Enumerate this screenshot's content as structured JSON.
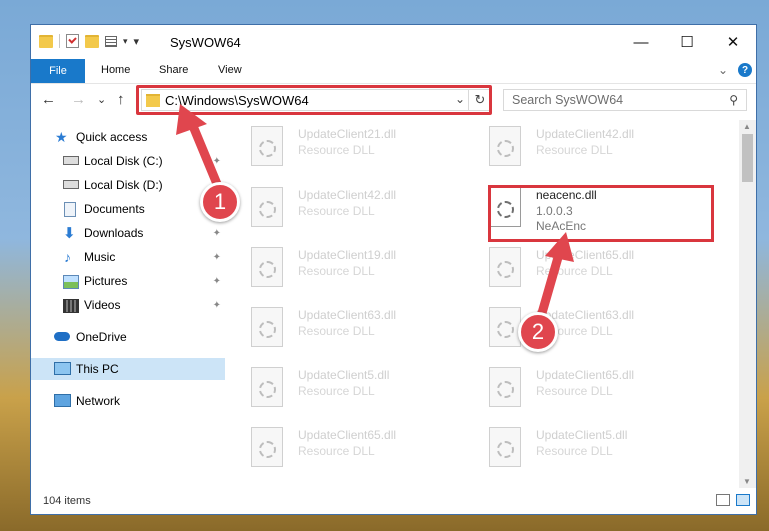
{
  "window": {
    "title": "SysWOW64",
    "close_glyph": "✕",
    "max_glyph": "☐",
    "min_glyph": "—"
  },
  "ribbon": {
    "file": "File",
    "tabs": [
      "Home",
      "Share",
      "View"
    ],
    "expand": "⌄",
    "help": "?"
  },
  "nav": {
    "back": "←",
    "forward": "→",
    "recent": "⌄",
    "up": "↑"
  },
  "address": {
    "path": "C:\\Windows\\SysWOW64",
    "dropdown": "⌄",
    "refresh": "↻"
  },
  "search": {
    "placeholder": "Search SysWOW64",
    "icon": "⚲"
  },
  "sidebar": {
    "items": [
      {
        "label": "Quick access",
        "icon": "star-icon",
        "color": "#2b7cd3"
      },
      {
        "label": "Local Disk (C:)",
        "icon": "drive-icon",
        "pinned": true
      },
      {
        "label": "Local Disk (D:)",
        "icon": "drive-icon"
      },
      {
        "label": "Documents",
        "icon": "documents-icon"
      },
      {
        "label": "Downloads",
        "icon": "download-icon",
        "pinned": true
      },
      {
        "label": "Music",
        "icon": "music-icon",
        "pinned": true
      },
      {
        "label": "Pictures",
        "icon": "pictures-icon",
        "pinned": true
      },
      {
        "label": "Videos",
        "icon": "videos-icon",
        "pinned": true
      },
      {
        "label": "OneDrive",
        "icon": "onedrive-icon"
      },
      {
        "label": "This PC",
        "icon": "pc-icon",
        "selected": true
      },
      {
        "label": "Network",
        "icon": "network-icon"
      }
    ],
    "pin_glyph": "📌"
  },
  "files": [
    {
      "name": "UpdateClient21.dll",
      "sub": "Resource DLL"
    },
    {
      "name": "UpdateClient42.dll",
      "sub": "Resource DLL"
    },
    {
      "name": "UpdateClient42.dll",
      "sub": "Resource DLL"
    },
    {
      "name": "neacenc.dll",
      "sub": "1.0.0.3",
      "sub2": "NeAcEnc",
      "highlight": true
    },
    {
      "name": "UpdateClient19.dll",
      "sub": "Resource DLL"
    },
    {
      "name": "UpdateClient65.dll",
      "sub": "Resource DLL"
    },
    {
      "name": "UpdateClient63.dll",
      "sub": "Resource DLL"
    },
    {
      "name": "UpdateClient63.dll",
      "sub": "Resource DLL"
    },
    {
      "name": "UpdateClient5.dll",
      "sub": "Resource DLL"
    },
    {
      "name": "UpdateClient65.dll",
      "sub": "Resource DLL"
    },
    {
      "name": "UpdateClient65.dll",
      "sub": "Resource DLL"
    },
    {
      "name": "UpdateClient5.dll",
      "sub": "Resource DLL"
    }
  ],
  "status": {
    "count": "104 items"
  },
  "annotations": {
    "one": "1",
    "two": "2",
    "color": "#e0464e"
  }
}
